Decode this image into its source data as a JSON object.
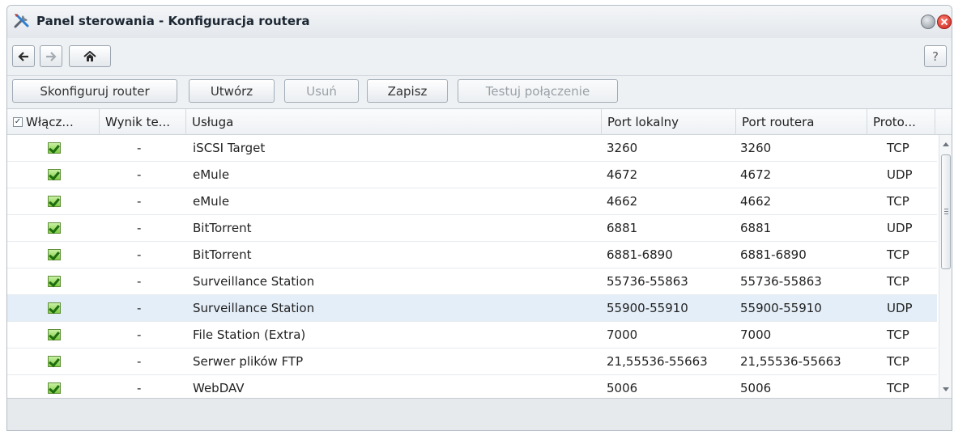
{
  "window": {
    "title": "Panel sterowania - Konfiguracja routera",
    "help_label": "?"
  },
  "toolbar": {
    "configure_label": "Skonfiguruj router",
    "create_label": "Utwórz",
    "delete_label": "Usuń",
    "save_label": "Zapisz",
    "test_label": "Testuj połączenie"
  },
  "grid": {
    "columns": {
      "enabled": "Włącz...",
      "result": "Wynik te...",
      "service": "Usługa",
      "local_port": "Port lokalny",
      "router_port": "Port routera",
      "protocol": "Proto..."
    },
    "rows": [
      {
        "enabled": true,
        "result": "-",
        "service": "iSCSI Target",
        "local_port": "3260",
        "router_port": "3260",
        "protocol": "TCP"
      },
      {
        "enabled": true,
        "result": "-",
        "service": "eMule",
        "local_port": "4672",
        "router_port": "4672",
        "protocol": "UDP"
      },
      {
        "enabled": true,
        "result": "-",
        "service": "eMule",
        "local_port": "4662",
        "router_port": "4662",
        "protocol": "TCP"
      },
      {
        "enabled": true,
        "result": "-",
        "service": "BitTorrent",
        "local_port": "6881",
        "router_port": "6881",
        "protocol": "UDP"
      },
      {
        "enabled": true,
        "result": "-",
        "service": "BitTorrent",
        "local_port": "6881-6890",
        "router_port": "6881-6890",
        "protocol": "TCP"
      },
      {
        "enabled": true,
        "result": "-",
        "service": "Surveillance Station",
        "local_port": "55736-55863",
        "router_port": "55736-55863",
        "protocol": "TCP"
      },
      {
        "enabled": true,
        "result": "-",
        "service": "Surveillance Station",
        "local_port": "55900-55910",
        "router_port": "55900-55910",
        "protocol": "UDP",
        "selected": true
      },
      {
        "enabled": true,
        "result": "-",
        "service": "File Station (Extra)",
        "local_port": "7000",
        "router_port": "7000",
        "protocol": "TCP"
      },
      {
        "enabled": true,
        "result": "-",
        "service": "Serwer plików FTP",
        "local_port": "21,55536-55663",
        "router_port": "21,55536-55663",
        "protocol": "TCP"
      },
      {
        "enabled": true,
        "result": "-",
        "service": "WebDAV",
        "local_port": "5006",
        "router_port": "5006",
        "protocol": "TCP"
      }
    ]
  },
  "icons": {
    "app": "tools-icon",
    "back": "arrow-left-icon",
    "forward": "arrow-right-icon",
    "home": "home-icon",
    "row_check": "green-checkbox-icon"
  },
  "colors": {
    "selected_row": "#e4eef8",
    "check_green": "#7fcc44",
    "close_red": "#c9271c"
  }
}
